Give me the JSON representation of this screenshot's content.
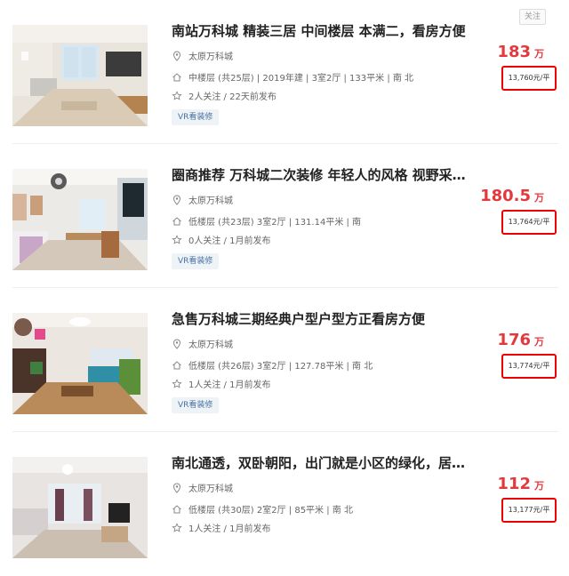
{
  "follow_button_label": "关注",
  "listings": [
    {
      "title": "南站万科城 精装三居 中间楼层 本满二，看房方便",
      "community": "太原万科城",
      "info": "中楼层 (共25层) | 2019年建 | 3室2厅 | 133平米 | 南 北",
      "follow": "2人关注 / 22天前发布",
      "tag": "VR看装修",
      "total_price": "183",
      "price_unit": "万",
      "unit_price": "13,760元/平"
    },
    {
      "title": "圈商推荐 万科城二次装修 年轻人的风格 视野采光好",
      "community": "太原万科城",
      "info": "低楼层 (共23层) 3室2厅 | 131.14平米 | 南",
      "follow": "0人关注 / 1月前发布",
      "tag": "VR看装修",
      "total_price": "180.5",
      "price_unit": "万",
      "unit_price": "13,764元/平"
    },
    {
      "title": "急售万科城三期经典户型户型方正看房方便",
      "community": "太原万科城",
      "info": "低楼层 (共26层) 3室2厅 | 127.78平米 | 南 北",
      "follow": "1人关注 / 1月前发布",
      "tag": "VR看装修",
      "total_price": "176",
      "price_unit": "万",
      "unit_price": "13,774元/平"
    },
    {
      "title": "南北通透，双卧朝阳，出门就是小区的绿化，居住舒适",
      "community": "太原万科城",
      "info": "低楼层 (共30层) 2室2厅 | 85平米 | 南 北",
      "follow": "1人关注 / 1月前发布",
      "tag": "",
      "total_price": "112",
      "price_unit": "万",
      "unit_price": "13,177元/平"
    }
  ],
  "icons": {
    "location": "location-pin-icon",
    "info": "house-icon",
    "follow": "star-icon"
  },
  "colors": {
    "price_red": "#e4393c",
    "highlight_box": "#e00000",
    "tag_bg": "#eef3f8",
    "tag_text": "#4a72a0"
  }
}
